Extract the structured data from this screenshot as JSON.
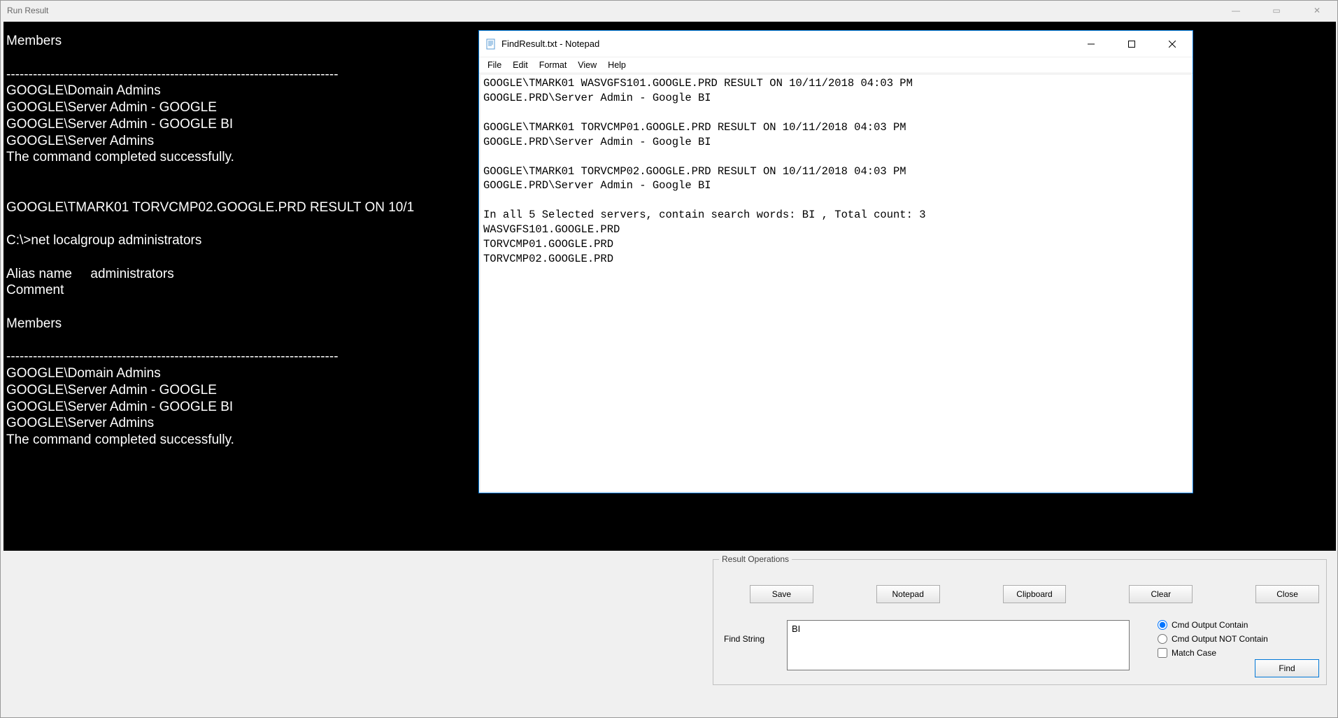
{
  "main_window": {
    "title": "Run Result"
  },
  "terminal": {
    "text": "Members\n\n---------------------------------------------------------------------------\nGOOGLE\\Domain Admins\nGOOGLE\\Server Admin - GOOGLE\nGOOGLE\\Server Admin - GOOGLE BI\nGOOGLE\\Server Admins\nThe command completed successfully.\n\n\nGOOGLE\\TMARK01 TORVCMP02.GOOGLE.PRD RESULT ON 10/1\n\nC:\\>net localgroup administrators\n\nAlias name     administrators\nComment\n\nMembers\n\n---------------------------------------------------------------------------\nGOOGLE\\Domain Admins\nGOOGLE\\Server Admin - GOOGLE\nGOOGLE\\Server Admin - GOOGLE BI\nGOOGLE\\Server Admins\nThe command completed successfully."
  },
  "notepad": {
    "title": "FindResult.txt - Notepad",
    "menu": {
      "file": "File",
      "edit": "Edit",
      "format": "Format",
      "view": "View",
      "help": "Help"
    },
    "content": "GOOGLE\\TMARK01 WASVGFS101.GOOGLE.PRD RESULT ON 10/11/2018 04:03 PM\nGOOGLE.PRD\\Server Admin - Google BI\n\nGOOGLE\\TMARK01 TORVCMP01.GOOGLE.PRD RESULT ON 10/11/2018 04:03 PM\nGOOGLE.PRD\\Server Admin - Google BI\n\nGOOGLE\\TMARK01 TORVCMP02.GOOGLE.PRD RESULT ON 10/11/2018 04:03 PM\nGOOGLE.PRD\\Server Admin - Google BI\n\nIn all 5 Selected servers, contain search words: BI , Total count: 3\nWASVGFS101.GOOGLE.PRD\nTORVCMP01.GOOGLE.PRD\nTORVCMP02.GOOGLE.PRD"
  },
  "result_ops": {
    "legend": "Result Operations",
    "buttons": {
      "save": "Save",
      "notepad": "Notepad",
      "clipboard": "Clipboard",
      "clear": "Clear",
      "close": "Close"
    },
    "find_label": "Find String",
    "find_value": "BI",
    "radios": {
      "contain": "Cmd Output Contain",
      "not_contain": "Cmd Output NOT Contain",
      "match_case": "Match Case"
    },
    "find_button": "Find"
  }
}
